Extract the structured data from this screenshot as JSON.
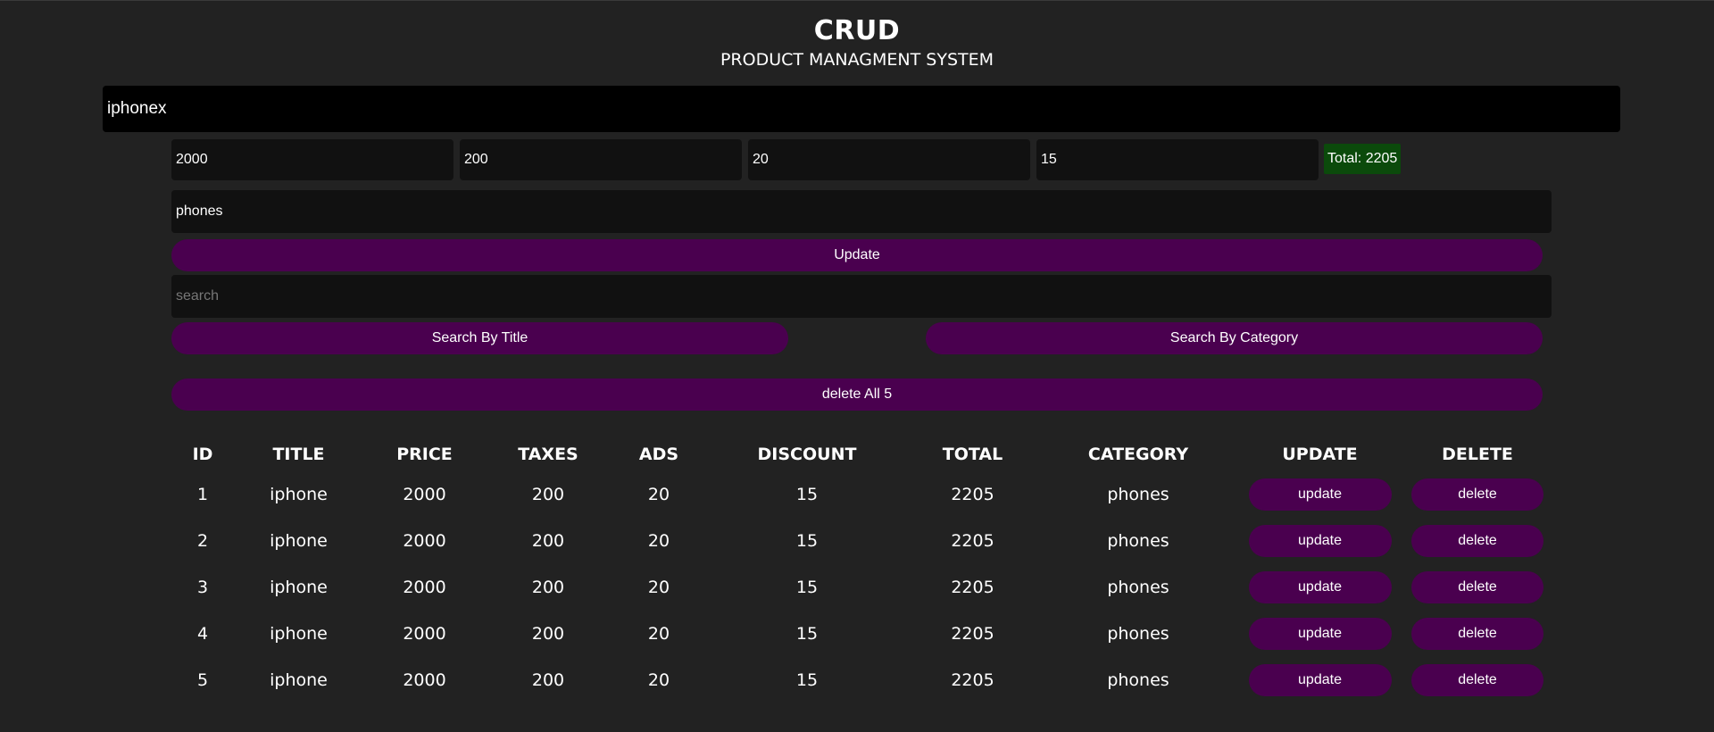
{
  "header": {
    "title": "CRUD",
    "subtitle": "PRODUCT MANAGMENT SYSTEM"
  },
  "form": {
    "title_value": "iphonex",
    "price_value": "2000",
    "taxes_value": "200",
    "ads_value": "20",
    "discount_value": "15",
    "total_label": "Total: 2205",
    "category_value": "phones",
    "submit_label": "Update"
  },
  "search": {
    "placeholder": "search",
    "by_title_label": "Search By Title",
    "by_category_label": "Search By Category"
  },
  "delete_all_label": "delete All 5",
  "table": {
    "headers": [
      "ID",
      "TITLE",
      "PRICE",
      "TAXES",
      "ADS",
      "DISCOUNT",
      "TOTAL",
      "CATEGORY",
      "UPDATE",
      "DELETE"
    ],
    "rows": [
      {
        "id": "1",
        "title": "iphone",
        "price": "2000",
        "taxes": "200",
        "ads": "20",
        "discount": "15",
        "total": "2205",
        "category": "phones",
        "update": "update",
        "delete": "delete"
      },
      {
        "id": "2",
        "title": "iphone",
        "price": "2000",
        "taxes": "200",
        "ads": "20",
        "discount": "15",
        "total": "2205",
        "category": "phones",
        "update": "update",
        "delete": "delete"
      },
      {
        "id": "3",
        "title": "iphone",
        "price": "2000",
        "taxes": "200",
        "ads": "20",
        "discount": "15",
        "total": "2205",
        "category": "phones",
        "update": "update",
        "delete": "delete"
      },
      {
        "id": "4",
        "title": "iphone",
        "price": "2000",
        "taxes": "200",
        "ads": "20",
        "discount": "15",
        "total": "2205",
        "category": "phones",
        "update": "update",
        "delete": "delete"
      },
      {
        "id": "5",
        "title": "iphone",
        "price": "2000",
        "taxes": "200",
        "ads": "20",
        "discount": "15",
        "total": "2205",
        "category": "phones",
        "update": "update",
        "delete": "delete"
      }
    ]
  },
  "colors": {
    "background": "#222222",
    "button_purple": "#4a004f",
    "total_badge_green": "#0b4a0b",
    "input_dark": "#111111",
    "title_input_black": "#000000"
  }
}
